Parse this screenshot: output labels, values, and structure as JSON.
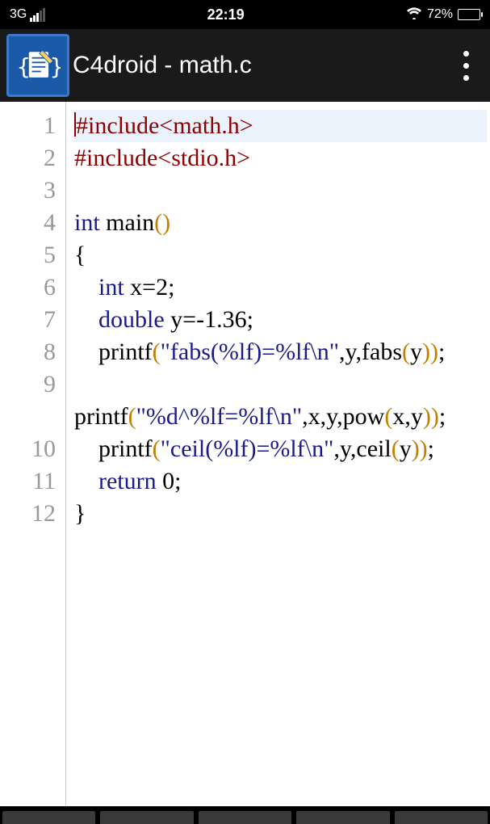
{
  "statusbar": {
    "network": "3G",
    "time": "22:19",
    "battery_pct": "72%"
  },
  "appbar": {
    "title": "C4droid - math.c"
  },
  "editor": {
    "highlighted_line": 1,
    "lines": [
      {
        "n": "1",
        "tokens": [
          {
            "c": "tk-pre",
            "t": "#include<math.h>"
          }
        ]
      },
      {
        "n": "2",
        "tokens": [
          {
            "c": "tk-pre",
            "t": "#include<stdio.h>"
          }
        ]
      },
      {
        "n": "3",
        "tokens": []
      },
      {
        "n": "4",
        "tokens": [
          {
            "c": "tk-kw",
            "t": "int"
          },
          {
            "c": "tk-plain",
            "t": " main"
          },
          {
            "c": "tk-par",
            "t": "()"
          }
        ]
      },
      {
        "n": "5",
        "tokens": [
          {
            "c": "tk-plain",
            "t": "{"
          }
        ]
      },
      {
        "n": "6",
        "tokens": [
          {
            "c": "tk-plain",
            "t": "    "
          },
          {
            "c": "tk-kw",
            "t": "int"
          },
          {
            "c": "tk-plain",
            "t": " x="
          },
          {
            "c": "tk-num",
            "t": "2"
          },
          {
            "c": "tk-plain",
            "t": ";"
          }
        ]
      },
      {
        "n": "7",
        "tokens": [
          {
            "c": "tk-plain",
            "t": "    "
          },
          {
            "c": "tk-kw",
            "t": "double"
          },
          {
            "c": "tk-plain",
            "t": " y=-"
          },
          {
            "c": "tk-num",
            "t": "1.36"
          },
          {
            "c": "tk-plain",
            "t": ";"
          }
        ]
      },
      {
        "n": "8",
        "tokens": [
          {
            "c": "tk-plain",
            "t": "    printf"
          },
          {
            "c": "tk-par",
            "t": "("
          },
          {
            "c": "tk-str",
            "t": "\"fabs(%lf)=%lf\\n\""
          },
          {
            "c": "tk-plain",
            "t": ",y,fabs"
          },
          {
            "c": "tk-par",
            "t": "("
          },
          {
            "c": "tk-plain",
            "t": "y"
          },
          {
            "c": "tk-par",
            "t": "))"
          },
          {
            "c": "tk-plain",
            "t": ";"
          }
        ]
      },
      {
        "n": "9",
        "tokens": [],
        "wraptail": [
          {
            "c": "tk-plain",
            "t": "printf"
          },
          {
            "c": "tk-par",
            "t": "("
          },
          {
            "c": "tk-str",
            "t": "\"%d^%lf=%lf\\n\""
          },
          {
            "c": "tk-plain",
            "t": ",x,y,pow"
          },
          {
            "c": "tk-par",
            "t": "("
          },
          {
            "c": "tk-plain",
            "t": "x,y"
          },
          {
            "c": "tk-par",
            "t": "))"
          },
          {
            "c": "tk-plain",
            "t": ";"
          }
        ]
      },
      {
        "n": "10",
        "tokens": [
          {
            "c": "tk-plain",
            "t": "    printf"
          },
          {
            "c": "tk-par",
            "t": "("
          },
          {
            "c": "tk-str",
            "t": "\"ceil(%lf)=%lf\\n\""
          },
          {
            "c": "tk-plain",
            "t": ",y,ceil"
          },
          {
            "c": "tk-par",
            "t": "("
          },
          {
            "c": "tk-plain",
            "t": "y"
          },
          {
            "c": "tk-par",
            "t": "))"
          },
          {
            "c": "tk-plain",
            "t": ";"
          }
        ]
      },
      {
        "n": "11",
        "tokens": [
          {
            "c": "tk-plain",
            "t": "    "
          },
          {
            "c": "tk-kw",
            "t": "return"
          },
          {
            "c": "tk-plain",
            "t": " "
          },
          {
            "c": "tk-num",
            "t": "0"
          },
          {
            "c": "tk-plain",
            "t": ";"
          }
        ]
      },
      {
        "n": "12",
        "tokens": [
          {
            "c": "tk-plain",
            "t": "}"
          }
        ]
      }
    ]
  }
}
